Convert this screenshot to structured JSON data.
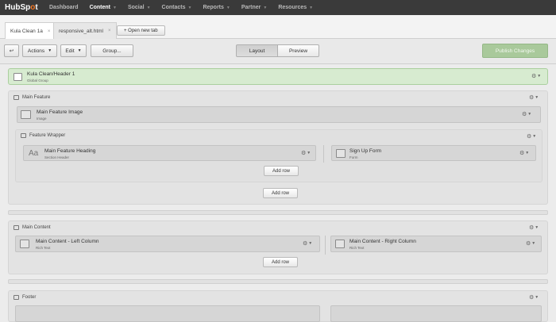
{
  "nav": {
    "logo_a": "HubSp",
    "logo_b": "o",
    "logo_c": "t",
    "items": [
      {
        "label": "Dashboard"
      },
      {
        "label": "Content"
      },
      {
        "label": "Social"
      },
      {
        "label": "Contacts"
      },
      {
        "label": "Reports"
      },
      {
        "label": "Partner"
      },
      {
        "label": "Resources"
      }
    ]
  },
  "tabs": [
    {
      "label": "Kula Clean 1a",
      "close": "×"
    },
    {
      "label": "responsive_alt.html",
      "close": "×"
    }
  ],
  "new_tab_label": "+ Open new tab",
  "toolbar": {
    "back": "↩",
    "actions": "Actions",
    "edit": "Edit",
    "group": "Group...",
    "layout": "Layout",
    "preview": "Preview",
    "publish": "Publish Changes"
  },
  "header_group": {
    "title": "Kula Clean/Header 1",
    "subtitle": "Global Group"
  },
  "main_feature": {
    "title": "Main Feature",
    "image_module": {
      "title": "Main Feature Image",
      "subtitle": "Image"
    },
    "wrapper": {
      "title": "Feature Wrapper",
      "left": {
        "title": "Main Feature Heading",
        "subtitle": "Section Header",
        "icon_text": "Aa"
      },
      "right": {
        "title": "Sign Up Form",
        "subtitle": "Form"
      },
      "add_row": "Add row"
    },
    "add_row": "Add row"
  },
  "main_content": {
    "title": "Main Content",
    "left": {
      "title": "Main Content - Left Column",
      "subtitle": "Rich Text"
    },
    "right": {
      "title": "Main Content - Right Column",
      "subtitle": "Rich Text"
    },
    "add_row": "Add row"
  },
  "footer": {
    "title": "Footer"
  },
  "gear_icon": "⚙",
  "caret": "▾"
}
